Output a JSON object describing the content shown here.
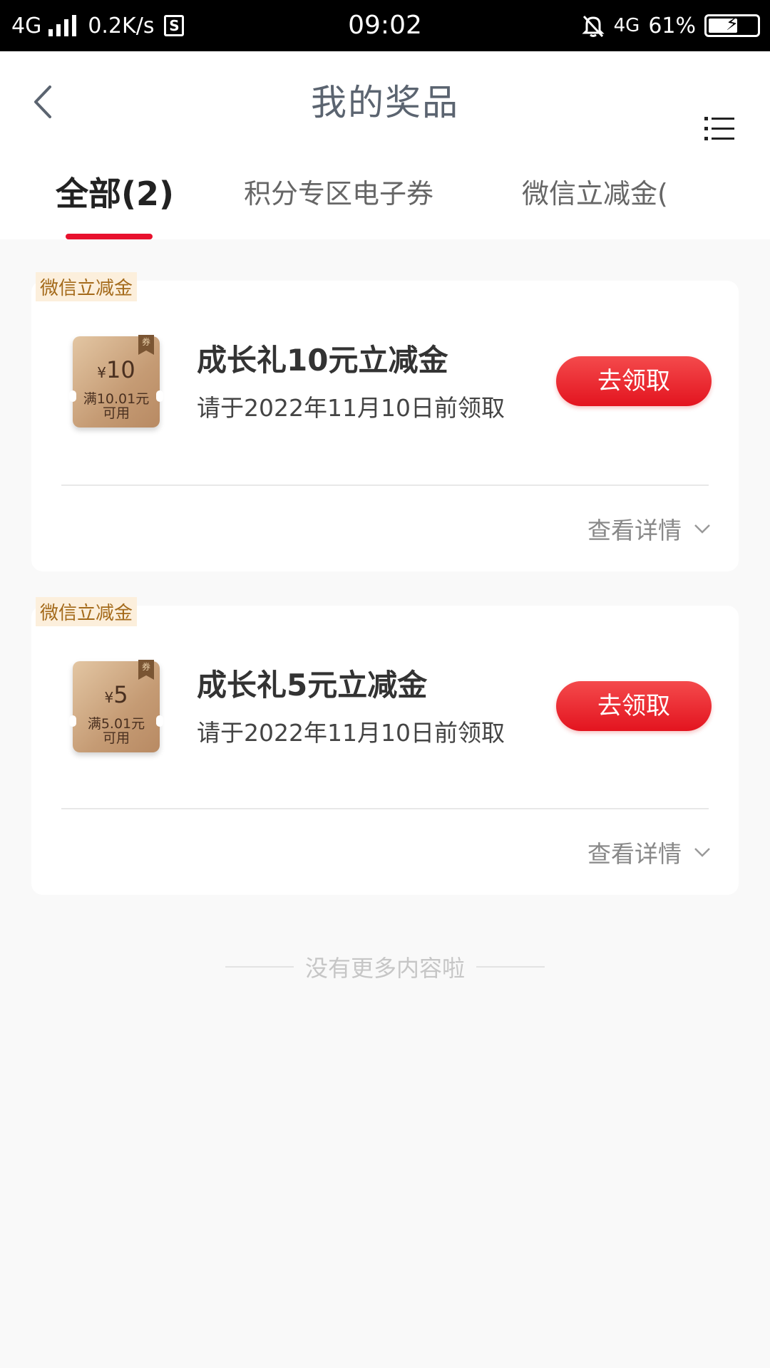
{
  "status_bar": {
    "network_left": "4G",
    "speed": "0.2K/s",
    "time": "09:02",
    "network_right": "4G",
    "battery": "61%",
    "battery_level": 0.61
  },
  "header": {
    "title": "我的奖品"
  },
  "tabs": [
    {
      "label": "全部(2)",
      "active": true
    },
    {
      "label": "积分专区电子券",
      "active": false
    },
    {
      "label": "微信立减金(",
      "active": false
    }
  ],
  "cards": [
    {
      "tag": "微信立减金",
      "coupon_currency": "¥",
      "coupon_amount": "10",
      "coupon_condition": "满10.01元",
      "coupon_usable": "可用",
      "coupon_ribbon": "券",
      "title": "成长礼10元立减金",
      "subtitle": "请于2022年11月10日前领取",
      "button": "去领取",
      "detail": "查看详情"
    },
    {
      "tag": "微信立减金",
      "coupon_currency": "¥",
      "coupon_amount": "5",
      "coupon_condition": "满5.01元",
      "coupon_usable": "可用",
      "coupon_ribbon": "券",
      "title": "成长礼5元立减金",
      "subtitle": "请于2022年11月10日前领取",
      "button": "去领取",
      "detail": "查看详情"
    }
  ],
  "footer": {
    "no_more": "没有更多内容啦"
  },
  "colors": {
    "accent": "#e8112d",
    "button": "#e3141f",
    "coupon": "#c59b74",
    "tag_text": "#a46a1a"
  }
}
